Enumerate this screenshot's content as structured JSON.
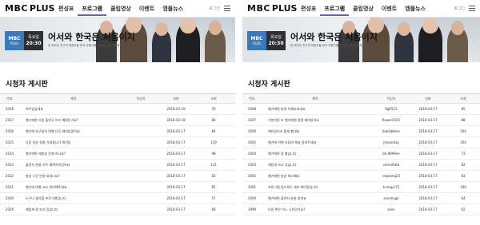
{
  "screens": [
    {
      "nav": {
        "logo_main": "MBC",
        "logo_sub": "PLUS",
        "items": [
          "편성표",
          "프로그램",
          "클립영상",
          "이벤트",
          "엠플뉴스"
        ],
        "active_index": 1,
        "login": "로그인"
      },
      "banner": {
        "channel_main": "MBC",
        "channel_sub": "PLUS",
        "air_day": "목요일",
        "air_time": "20:30",
        "show_title": "어서와 한국은 처음이지",
        "show_subtitle": "한 외국인 친구의 좌충우돌 한국 여행기를 통해 한국을 새롭게 바라본다"
      },
      "board": {
        "title": "시청자 게시판",
        "columns": [
          "번호",
          "제목",
          "작성자",
          "날짜",
          "조회"
        ],
        "rows": [
          {
            "no": "2038",
            "title": "여우있었네요",
            "author": "",
            "date": "2018-03-19",
            "views": "76"
          },
          {
            "no": "2037",
            "title": "벨기에편 다음 출연국 어디 예정인가요?",
            "author": "",
            "date": "2018-03-18",
            "views": "86"
          },
          {
            "no": "2036",
            "title": "벨기에 친구들의 여행 너무 재미있었어요",
            "author": "",
            "date": "2018-03-17",
            "views": "84"
          },
          {
            "no": "2035",
            "title": "다음 방송 정말 기대됩니다 화이팅",
            "author": "",
            "date": "2018-03-17",
            "views": "129"
          },
          {
            "no": "2034",
            "title": "벨기에편 재방송 언제 하나요?",
            "author": "",
            "date": "2018-03-17",
            "views": "98"
          },
          {
            "no": "2033",
            "title": "출연자 분들 모두 매력적이었어요",
            "author": "",
            "date": "2018-03-17",
            "views": "131"
          },
          {
            "no": "2032",
            "title": "방송 시간 변경 되었나요?",
            "author": "",
            "date": "2018-03-17",
            "views": "83"
          },
          {
            "no": "2031",
            "title": "벨기에 여행 코스 정리해주세요",
            "author": "",
            "date": "2018-03-17",
            "views": "85"
          },
          {
            "no": "2030",
            "title": "누구나 좋아할 프로그램입니다",
            "author": "",
            "date": "2018-03-17",
            "views": "57"
          },
          {
            "no": "2029",
            "title": "재밌게 잘 보고 있습니다",
            "author": "",
            "date": "2018-03-17",
            "views": "68"
          }
        ]
      }
    },
    {
      "nav": {
        "logo_main": "MBC",
        "logo_sub": "PLUS",
        "items": [
          "편성표",
          "프로그램",
          "클립영상",
          "이벤트",
          "엠플뉴스"
        ],
        "active_index": 1,
        "login": "로그인"
      },
      "banner": {
        "channel_main": "MBC",
        "channel_sub": "PLUS",
        "air_day": "목요일",
        "air_time": "20:30",
        "show_title": "어서와 한국은 처음이지",
        "show_subtitle": "한 외국인 친구의 좌충우돌 한국 여행기를 통해 한국을 새롭게 바라본다"
      },
      "board": {
        "title": "시청자 게시판",
        "columns": [
          "번호",
          "제목",
          "작성자",
          "날짜",
          "조회"
        ],
        "rows": [
          {
            "no": "2008",
            "title": "벨기에편 방영 이제부터네요",
            "author": "fig0515",
            "date": "2018-03-17",
            "views": "85"
          },
          {
            "no": "2007",
            "title": "수현이랑 또 벨기에편 정말 재미있어요",
            "author": "flower0101",
            "date": "2018-03-17",
            "views": "88"
          },
          {
            "no": "2006",
            "title": "재미있어서 밤새 봤네요",
            "author": "jbw4jbtees",
            "date": "2018-03-17",
            "views": "104"
          },
          {
            "no": "2005",
            "title": "벨기에 여행 유튜버 채널 알려주세요",
            "author": "jmoonday",
            "date": "2018-03-17",
            "views": "104"
          },
          {
            "no": "2004",
            "title": "벨기에편 잘 봤습니다",
            "author": "bh.8999ee",
            "date": "2018-03-17",
            "views": "73"
          },
          {
            "no": "2003",
            "title": "재밌게 보고 있습니다",
            "author": "vormdfabt",
            "date": "2018-03-17",
            "views": "82"
          },
          {
            "no": "2002",
            "title": "벨기에편 방송 최고예요",
            "author": "sepeonq23",
            "date": "2018-03-17",
            "views": "83"
          },
          {
            "no": "2001",
            "title": "프로그램 앞으로도 계속 화이팅입니다",
            "author": "knmgyr75",
            "date": "2018-03-17",
            "views": "106"
          },
          {
            "no": "2000",
            "title": "벨기에편 출연자 분들 멋져요",
            "author": "seonhygk",
            "date": "2018-03-17",
            "views": "64"
          },
          {
            "no": "1999",
            "title": "다음 편은 어느 나라인가요?",
            "author": "zeon",
            "date": "2018-03-17",
            "views": "62"
          }
        ]
      }
    }
  ],
  "colors": {
    "accent": "#7b5aa6",
    "channel_box": "#3b79b9",
    "air_box": "#2e2e33"
  }
}
